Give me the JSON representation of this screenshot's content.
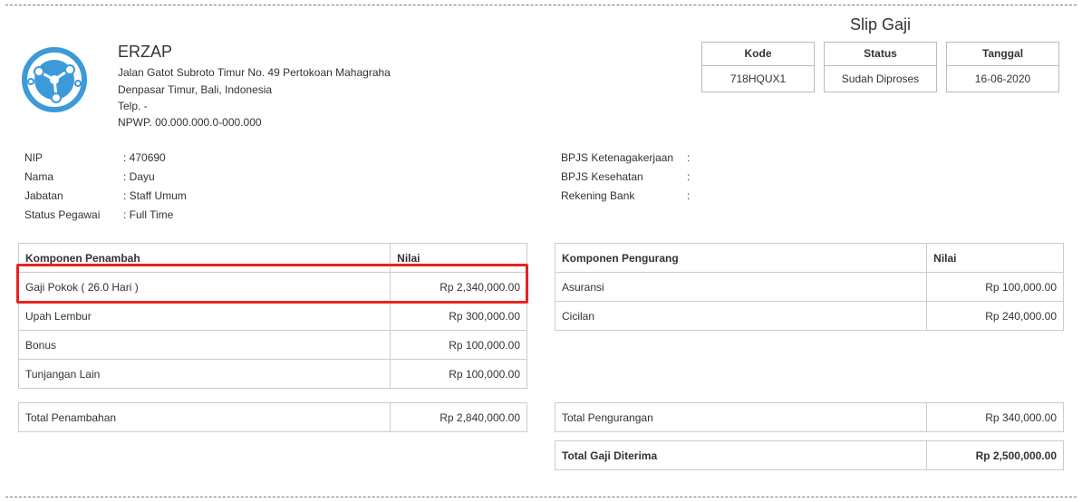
{
  "slip": {
    "title": "Slip Gaji"
  },
  "company": {
    "name": "ERZAP",
    "address1": "Jalan Gatot Subroto Timur No. 49 Pertokoan Mahagraha",
    "address2": "Denpasar Timur, Bali, Indonesia",
    "phone": "Telp. -",
    "npwp": "NPWP. 00.000.000.0-000.000",
    "logo_icon": "erzap-logo-icon",
    "logo_color": "#3d9ad8"
  },
  "meta": [
    {
      "header": "Kode",
      "value": "718HQUX1"
    },
    {
      "header": "Status",
      "value": "Sudah Diproses"
    },
    {
      "header": "Tanggal",
      "value": "16-06-2020"
    }
  ],
  "employee_left": [
    {
      "label": "NIP",
      "value": ": 470690"
    },
    {
      "label": "Nama",
      "value": ": Dayu"
    },
    {
      "label": "Jabatan",
      "value": ": Staff Umum"
    },
    {
      "label": "Status Pegawai",
      "value": ": Full Time"
    }
  ],
  "employee_right": [
    {
      "label": "BPJS Ketenagakerjaan",
      "value": ":"
    },
    {
      "label": "BPJS Kesehatan",
      "value": ":"
    },
    {
      "label": "Rekening Bank",
      "value": ":"
    }
  ],
  "additions": {
    "header_label": "Komponen Penambah",
    "header_value": "Nilai",
    "rows": [
      {
        "label": "Gaji Pokok ( 26.0 Hari )",
        "value": "Rp 2,340,000.00"
      },
      {
        "label": "Upah Lembur",
        "value": "Rp 300,000.00"
      },
      {
        "label": "Bonus",
        "value": "Rp 100,000.00"
      },
      {
        "label": "Tunjangan Lain",
        "value": "Rp 100,000.00"
      }
    ],
    "total_label": "Total Penambahan",
    "total_value": "Rp 2,840,000.00"
  },
  "deductions": {
    "header_label": "Komponen Pengurang",
    "header_value": "Nilai",
    "rows": [
      {
        "label": "Asuransi",
        "value": "Rp 100,000.00"
      },
      {
        "label": "Cicilan",
        "value": "Rp 240,000.00"
      }
    ],
    "total_label": "Total Pengurangan",
    "total_value": "Rp 340,000.00"
  },
  "net": {
    "label": "Total Gaji Diterima",
    "value": "Rp 2,500,000.00"
  },
  "highlight_color": "#e8231f"
}
